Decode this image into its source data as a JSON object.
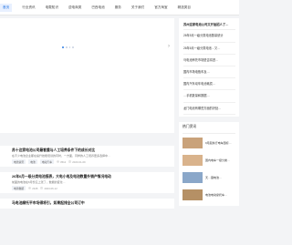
{
  "nav": {
    "items": [
      "首页",
      "行业资讯",
      "电载知识",
      "逆电商类",
      "巴西电池",
      "服务",
      "关于我们",
      "官方淘宝",
      "精选类目"
    ]
  },
  "banner": {
    "dot_count": 4,
    "active_dot": 0
  },
  "sidebar": {
    "items": [
      "苏州这家电池公司又开始招人了…",
      "26年5月一级分类电池数量统计",
      "26年6月一级分类电池…又…",
      "马电池摩托市场是否将进…",
      "国内市场电瓶车及…",
      "国内汽车动车电池耗损…",
      "…手机数量和数据…",
      "龙门电池有哪些方面的好处…"
    ],
    "hot_title": "热门资讯",
    "hot_items": [
      "9月起执行电车国标…",
      "国内电车一级分类…",
      "天…锂电池…",
      "电池电动摩托车…"
    ]
  },
  "articles": [
    {
      "title": "苏十这家电池公司最看重与人工培养条件下的成长对比",
      "desc": "在不少电池企业都在提升技能培训的同时，一方面，同样的人工培养更多选择中…",
      "tags": [
        "电池资讯",
        "电池",
        "电动汽车"
      ],
      "views": "3512",
      "date": "2023-01-09"
    },
    {
      "title": "26年6月一级分类电池报表，大电小电及电池数量外销产情况电动",
      "desc": "前面的电池在6月份又上涨了，数据的变化…",
      "tags": [
        "电池数据"
      ],
      "views": "2345",
      "date": "2023-06-12"
    },
    {
      "title": "马电池摩托平市场得将引，如果起排全公司订中",
      "desc": "",
      "tags": [],
      "views": "",
      "date": ""
    }
  ],
  "colors": {
    "accent": "#2b7be4",
    "page_bg": "#f3f4f6"
  }
}
